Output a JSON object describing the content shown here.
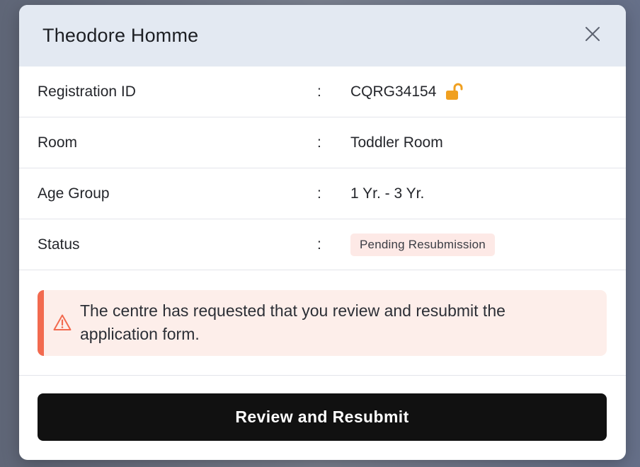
{
  "modal": {
    "title": "Theodore Homme",
    "close_icon": "close-icon"
  },
  "details": {
    "colon": ":",
    "registration": {
      "label": "Registration ID",
      "value": "CQRG34154",
      "icon": "unlock-icon",
      "icon_color": "#f0a020"
    },
    "room": {
      "label": "Room",
      "value": "Toddler Room"
    },
    "age_group": {
      "label": "Age Group",
      "value": "1 Yr. - 3 Yr."
    },
    "status": {
      "label": "Status",
      "value": "Pending Resubmission",
      "badge_bg": "#fde9e6"
    }
  },
  "alert": {
    "icon": "warning-icon",
    "accent_color": "#f26a4f",
    "line1": "The centre has requested that you review and resubmit the",
    "line2": "application form."
  },
  "footer": {
    "primary_button": "Review and Resubmit"
  }
}
